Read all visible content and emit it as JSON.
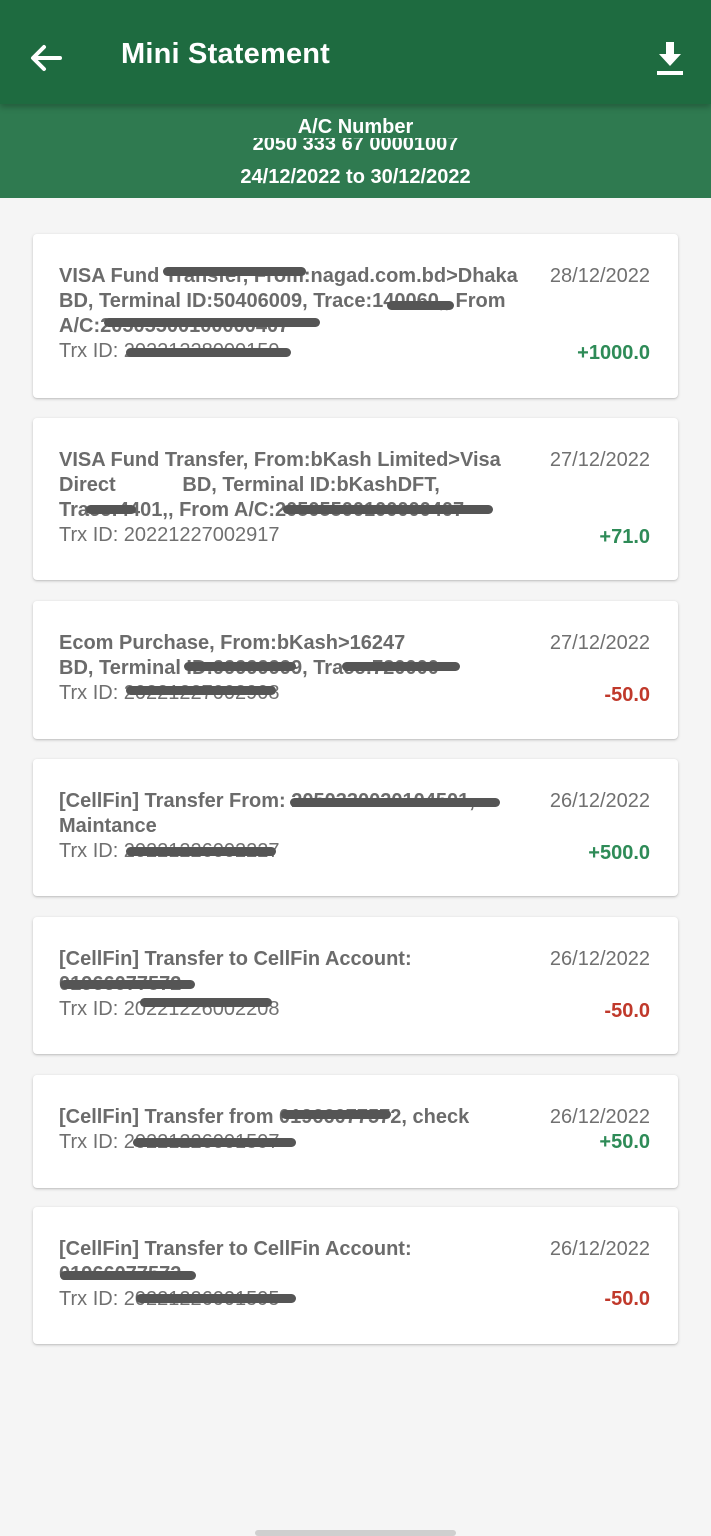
{
  "appbar": {
    "title": "Mini Statement",
    "back_icon": "arrow-left-icon",
    "download_icon": "download-icon"
  },
  "account": {
    "label": "A/C Number",
    "number": "2050 333 67 00001007",
    "period": "24/12/2022 to 30/12/2022"
  },
  "colors": {
    "appbar": "#1e6b40",
    "band": "#2f7a50",
    "credit": "#2e8b57",
    "debit": "#c0392b"
  },
  "transactions": [
    {
      "desc_lines": [
        "VISA Fund Transfer, From:nagad.com.bd>Dhaka",
        "BD, Terminal ID:50406009, Trace:140060,, From",
        "A/C:20505500100000407"
      ],
      "trx": "Trx ID: 20221228000159",
      "date": "28/12/2022",
      "amount": "+1000.0"
    },
    {
      "desc_lines": [
        "VISA Fund Transfer, From:bKash Limited>Visa",
        "Direct            BD, Terminal ID:bKashDFT,",
        "Trace:4401,, From A/C:20505500100000407"
      ],
      "trx": "Trx ID: 20221227002917",
      "date": "27/12/2022",
      "amount": "+71.0"
    },
    {
      "desc_lines": [
        "Ecom Purchase, From:bKash>16247",
        "BD, Terminal ID:99999999, Trace:720000"
      ],
      "trx": "Trx ID: 20221227002908",
      "date": "27/12/2022",
      "amount": "-50.0"
    },
    {
      "desc_lines": [
        "[CellFin] Transfer From: 2050330020104501,",
        "Maintance"
      ],
      "trx": "Trx ID: 20221226002227",
      "date": "26/12/2022",
      "amount": "+500.0"
    },
    {
      "desc_lines": [
        "[CellFin] Transfer to CellFin Account:",
        "01966077572"
      ],
      "trx": "Trx ID: 20221226002208",
      "date": "26/12/2022",
      "amount": "-50.0"
    },
    {
      "desc_lines": [
        "[CellFin] Transfer from 01966077572, check"
      ],
      "trx": "Trx ID: 20221226001597",
      "date": "26/12/2022",
      "amount": "+50.0"
    },
    {
      "desc_lines": [
        "[CellFin] Transfer to CellFin Account:",
        "01966077572"
      ],
      "trx": "Trx ID: 20221226001595",
      "date": "26/12/2022",
      "amount": "-50.0"
    }
  ]
}
